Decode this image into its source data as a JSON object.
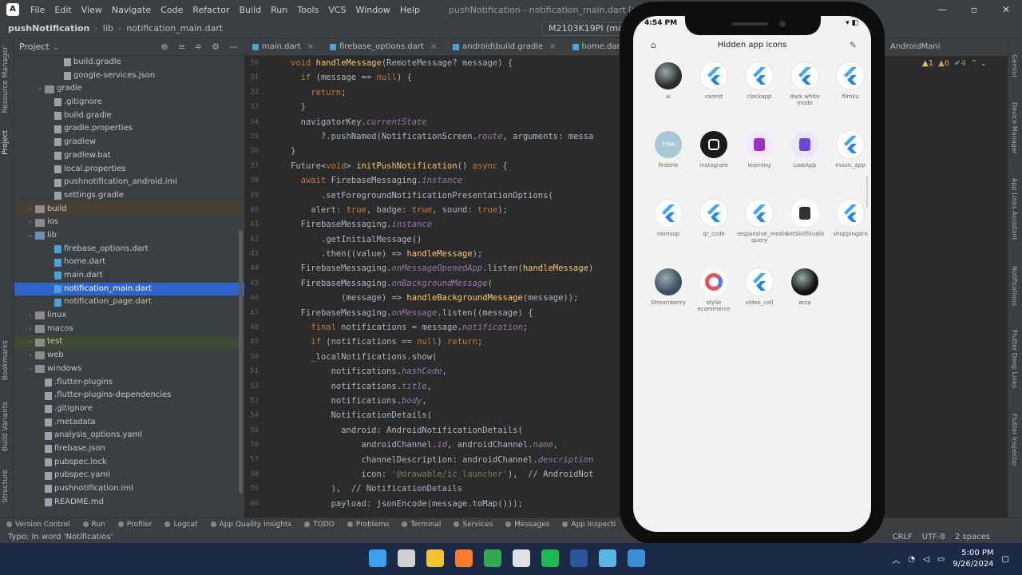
{
  "window": {
    "title": "pushNotification - notification_main.dart [pushnotification]",
    "menu": [
      "File",
      "Edit",
      "View",
      "Navigate",
      "Code",
      "Refactor",
      "Build",
      "Run",
      "Tools",
      "VCS",
      "Window",
      "Help"
    ]
  },
  "navbar": {
    "project": "pushNotification",
    "folder": "lib",
    "file": "notification_main.dart",
    "device": "M2103K19PI (mob"
  },
  "project_panel": {
    "title": "Project",
    "items": [
      {
        "label": "build.gradle",
        "indent": 5,
        "type": "file"
      },
      {
        "label": "google-services.json",
        "indent": 5,
        "type": "file"
      },
      {
        "label": "gradle",
        "indent": 3,
        "type": "folder",
        "caret": "›"
      },
      {
        "label": ".gitignore",
        "indent": 4,
        "type": "file"
      },
      {
        "label": "build.gradle",
        "indent": 4,
        "type": "file"
      },
      {
        "label": "gradle.properties",
        "indent": 4,
        "type": "file"
      },
      {
        "label": "gradlew",
        "indent": 4,
        "type": "file"
      },
      {
        "label": "gradlew.bat",
        "indent": 4,
        "type": "file"
      },
      {
        "label": "local.properties",
        "indent": 4,
        "type": "file"
      },
      {
        "label": "pushnotification_android.iml",
        "indent": 4,
        "type": "file"
      },
      {
        "label": "settings.gradle",
        "indent": 4,
        "type": "file"
      },
      {
        "label": "build",
        "indent": 2,
        "type": "folder",
        "caret": "›",
        "hl": "brown"
      },
      {
        "label": "ios",
        "indent": 2,
        "type": "folder",
        "caret": "›"
      },
      {
        "label": "lib",
        "indent": 2,
        "type": "folderb",
        "caret": "⌄"
      },
      {
        "label": "firebase_options.dart",
        "indent": 4,
        "type": "dart"
      },
      {
        "label": "home.dart",
        "indent": 4,
        "type": "dart"
      },
      {
        "label": "main.dart",
        "indent": 4,
        "type": "dart"
      },
      {
        "label": "notification_main.dart",
        "indent": 4,
        "type": "dart",
        "hl": "sel"
      },
      {
        "label": "notification_page.dart",
        "indent": 4,
        "type": "dart"
      },
      {
        "label": "linux",
        "indent": 2,
        "type": "folder",
        "caret": "›"
      },
      {
        "label": "macos",
        "indent": 2,
        "type": "folder",
        "caret": "›"
      },
      {
        "label": "test",
        "indent": 2,
        "type": "folder",
        "caret": "›",
        "hl": "green"
      },
      {
        "label": "web",
        "indent": 2,
        "type": "folder",
        "caret": "›"
      },
      {
        "label": "windows",
        "indent": 2,
        "type": "folder",
        "caret": "›"
      },
      {
        "label": ".flutter-plugins",
        "indent": 3,
        "type": "file"
      },
      {
        "label": ".flutter-plugins-dependencies",
        "indent": 3,
        "type": "file"
      },
      {
        "label": ".gitignore",
        "indent": 3,
        "type": "file"
      },
      {
        "label": ".metadata",
        "indent": 3,
        "type": "file"
      },
      {
        "label": "analysis_options.yaml",
        "indent": 3,
        "type": "file"
      },
      {
        "label": "firebase.json",
        "indent": 3,
        "type": "file"
      },
      {
        "label": "pubspec.lock",
        "indent": 3,
        "type": "file"
      },
      {
        "label": "pubspec.yaml",
        "indent": 3,
        "type": "file"
      },
      {
        "label": "pushnotification.iml",
        "indent": 3,
        "type": "file"
      },
      {
        "label": "README.md",
        "indent": 3,
        "type": "file"
      }
    ]
  },
  "left_tool_labels": [
    "Resource Manager",
    "Project",
    "Bookmarks",
    "Build Variants",
    "Structure"
  ],
  "editor_tabs": [
    "main.dart",
    "firebase_options.dart",
    "android\\build.gradle",
    "home.dart"
  ],
  "right_tab": "AndroidMani",
  "warnings": {
    "warn": "▲1",
    "weak": "▲6",
    "ok": "✔4"
  },
  "code_lines": [
    {
      "n": "30",
      "t": "void handleMessage(RemoteMessage? message) {"
    },
    {
      "n": "31",
      "t": "  if (message == null) {"
    },
    {
      "n": "32",
      "t": "    return;"
    },
    {
      "n": "33",
      "t": "  }"
    },
    {
      "n": "34",
      "t": "  navigatorKey.currentState"
    },
    {
      "n": "35",
      "t": "      ?.pushNamed(NotificationScreen.route, arguments: messa"
    },
    {
      "n": "36",
      "t": "}"
    },
    {
      "n": "37",
      "t": "Future<void> initPushNotification() async {"
    },
    {
      "n": "38",
      "t": "  await FirebaseMessaging.instance"
    },
    {
      "n": "39",
      "t": "      .setForegroundNotificationPresentationOptions("
    },
    {
      "n": "40",
      "t": "    alert: true, badge: true, sound: true);"
    },
    {
      "n": "41",
      "t": "  FirebaseMessaging.instance"
    },
    {
      "n": "42",
      "t": "      .getInitialMessage()"
    },
    {
      "n": "43",
      "t": "      .then((value) => handleMessage);"
    },
    {
      "n": "44",
      "t": "  FirebaseMessaging.onMessageOpenedApp.listen(handleMessage)"
    },
    {
      "n": "45",
      "t": "  FirebaseMessaging.onBackgroundMessage("
    },
    {
      "n": "46",
      "t": "          (message) => handleBackgroundMessage(message));"
    },
    {
      "n": "47",
      "t": "  FirebaseMessaging.onMessage.listen((message) {"
    },
    {
      "n": "48",
      "t": "    final notifications = message.notification;"
    },
    {
      "n": "49",
      "t": "    if (notifications == null) return;"
    },
    {
      "n": "50",
      "t": "    _localNotifications.show("
    },
    {
      "n": "51",
      "t": "        notifications.hashCode,"
    },
    {
      "n": "52",
      "t": "        notifications.title,"
    },
    {
      "n": "53",
      "t": "        notifications.body,"
    },
    {
      "n": "54",
      "t": "        NotificationDetails("
    },
    {
      "n": "55",
      "t": "          android: AndroidNotificationDetails("
    },
    {
      "n": "56",
      "t": "              androidChannel.id, androidChannel.name,"
    },
    {
      "n": "57",
      "t": "              channelDescription: androidChannel.description"
    },
    {
      "n": "58",
      "t": "              icon: '@drawable/ic_launcher'),  // AndroidNot"
    },
    {
      "n": "59",
      "t": "        ),  // NotificationDetails"
    },
    {
      "n": "60",
      "t": "        payload: jsonEncode(message.toMap()));"
    }
  ],
  "status_tools": [
    "Version Control",
    "Run",
    "Profiler",
    "Logcat",
    "App Quality Insights",
    "TODO",
    "Problems",
    "Terminal",
    "Services",
    "Messages",
    "App Inspecti"
  ],
  "status_message": "Typo: In word 'Notificatios'",
  "status_right": [
    "CRLF",
    "UTF-8",
    "2 spaces"
  ],
  "right_tool_labels": [
    "Gemini",
    "Device Manager",
    "App Links Assistant",
    "Notifications",
    "Flutter Deep Links",
    "Flutter Inspector",
    "Flutter Outline"
  ],
  "phone": {
    "time": "4:54 PM",
    "status_right": "▾ ◧",
    "header_title": "Hidden app icons",
    "apps": [
      {
        "label": "ai",
        "kind": "photo",
        "color": "#2a2a2a"
      },
      {
        "label": "carent",
        "kind": "flutter"
      },
      {
        "label": "clockapp",
        "kind": "flutter"
      },
      {
        "label": "dark white mode",
        "kind": "flutter"
      },
      {
        "label": "filmku",
        "kind": "flutter"
      },
      {
        "label": "firstme",
        "kind": "text",
        "color": "#a9c9d6",
        "text": "TIRA"
      },
      {
        "label": "instagram",
        "kind": "insta",
        "color": "#1a1a1a"
      },
      {
        "label": "learning",
        "kind": "box",
        "color": "#f2e7fb",
        "inner": "#9b2fc7"
      },
      {
        "label": "LostApp",
        "kind": "box",
        "color": "#ece6fb",
        "inner": "#6a46e0"
      },
      {
        "label": "music_app",
        "kind": "flutter"
      },
      {
        "label": "nomsop",
        "kind": "flutter"
      },
      {
        "label": "qr_code",
        "kind": "flutter"
      },
      {
        "label": "responsive_media query",
        "kind": "flutter"
      },
      {
        "label": "SetSkillStudio",
        "kind": "box",
        "color": "#ffffff",
        "inner": "#333333"
      },
      {
        "label": "shoppingdro",
        "kind": "flutter"
      },
      {
        "label": "Streamberry",
        "kind": "photo",
        "color": "#3b4f66"
      },
      {
        "label": "stylle ecommerce",
        "kind": "ring",
        "color": "#ffffff"
      },
      {
        "label": "video_call",
        "kind": "flutter"
      },
      {
        "label": "wiza",
        "kind": "photo",
        "color": "#111111"
      }
    ]
  },
  "taskbar": {
    "time": "5:00 PM",
    "date": "9/26/2024",
    "icons": [
      {
        "name": "windows-start-icon",
        "color": "#3aa0f0"
      },
      {
        "name": "task-view-icon",
        "color": "#d0d0d0"
      },
      {
        "name": "file-explorer-icon",
        "color": "#f2c230"
      },
      {
        "name": "firefox-icon",
        "color": "#ff7a2c"
      },
      {
        "name": "chrome-icon",
        "color": "#34a853"
      },
      {
        "name": "media-icon",
        "color": "#e0e0e0"
      },
      {
        "name": "spotify-icon",
        "color": "#1db954"
      },
      {
        "name": "word-icon",
        "color": "#2b579a"
      },
      {
        "name": "notepad-icon",
        "color": "#5ab4e6"
      },
      {
        "name": "android-studio-icon",
        "color": "#3c8fd6"
      }
    ]
  },
  "colors": {
    "keyword": "#cc7832",
    "method": "#ffc66d",
    "field": "#9876aa",
    "string": "#6a8759",
    "comment": "#808080"
  }
}
